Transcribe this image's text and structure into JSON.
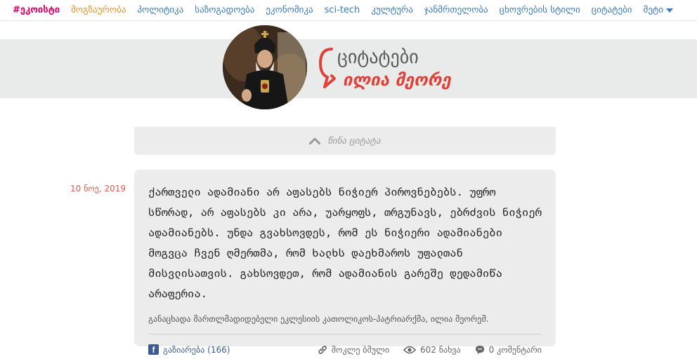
{
  "nav": {
    "brand": "#ეკოისტი",
    "items": [
      "მოგზაურობა",
      "პოლიტიკა",
      "საზოგადოება",
      "ეკონომიკა",
      "sci-tech",
      "კულტურა",
      "ჯანმრთელობა",
      "ცხოვრების სტილი",
      "ციტატები"
    ],
    "more": "მეტი"
  },
  "banner": {
    "title": "ციტატები",
    "subtitle": "ილია მეორე"
  },
  "prev": {
    "label": "წინა ციტატა"
  },
  "post": {
    "date": "10 ნოე, 2019",
    "quote": "ქართველი ადამიანი არ აფასებს ნიჭიერ პიროვნებებს. უფრო სწორად, არ აფასებს კი არა, უარყოფს, თრგუნავს, ებრძვის ნიჭიერ ადამიანებს. უნდა გვახსოვდეს, რომ ეს ნიჭიერი ადამიანები მოგვცა ჩვენ ღმერთმა, რომ ხალხს დაეხმაროს უფალთან მისვლისათვის. გახსოვდეთ, რომ ადამიანის გარეშე დედამიწა არაფერია.",
    "source": "განაცხადა მართლმადიდებელი ეკლესიის კათოლიკოს-პატრიარქმა, ილია მეორემ.",
    "share": "გაზიარება (166)",
    "short_link": "მოკლე ბმული",
    "views": "602 ნახვა",
    "comments": "0 კომენტარი"
  }
}
